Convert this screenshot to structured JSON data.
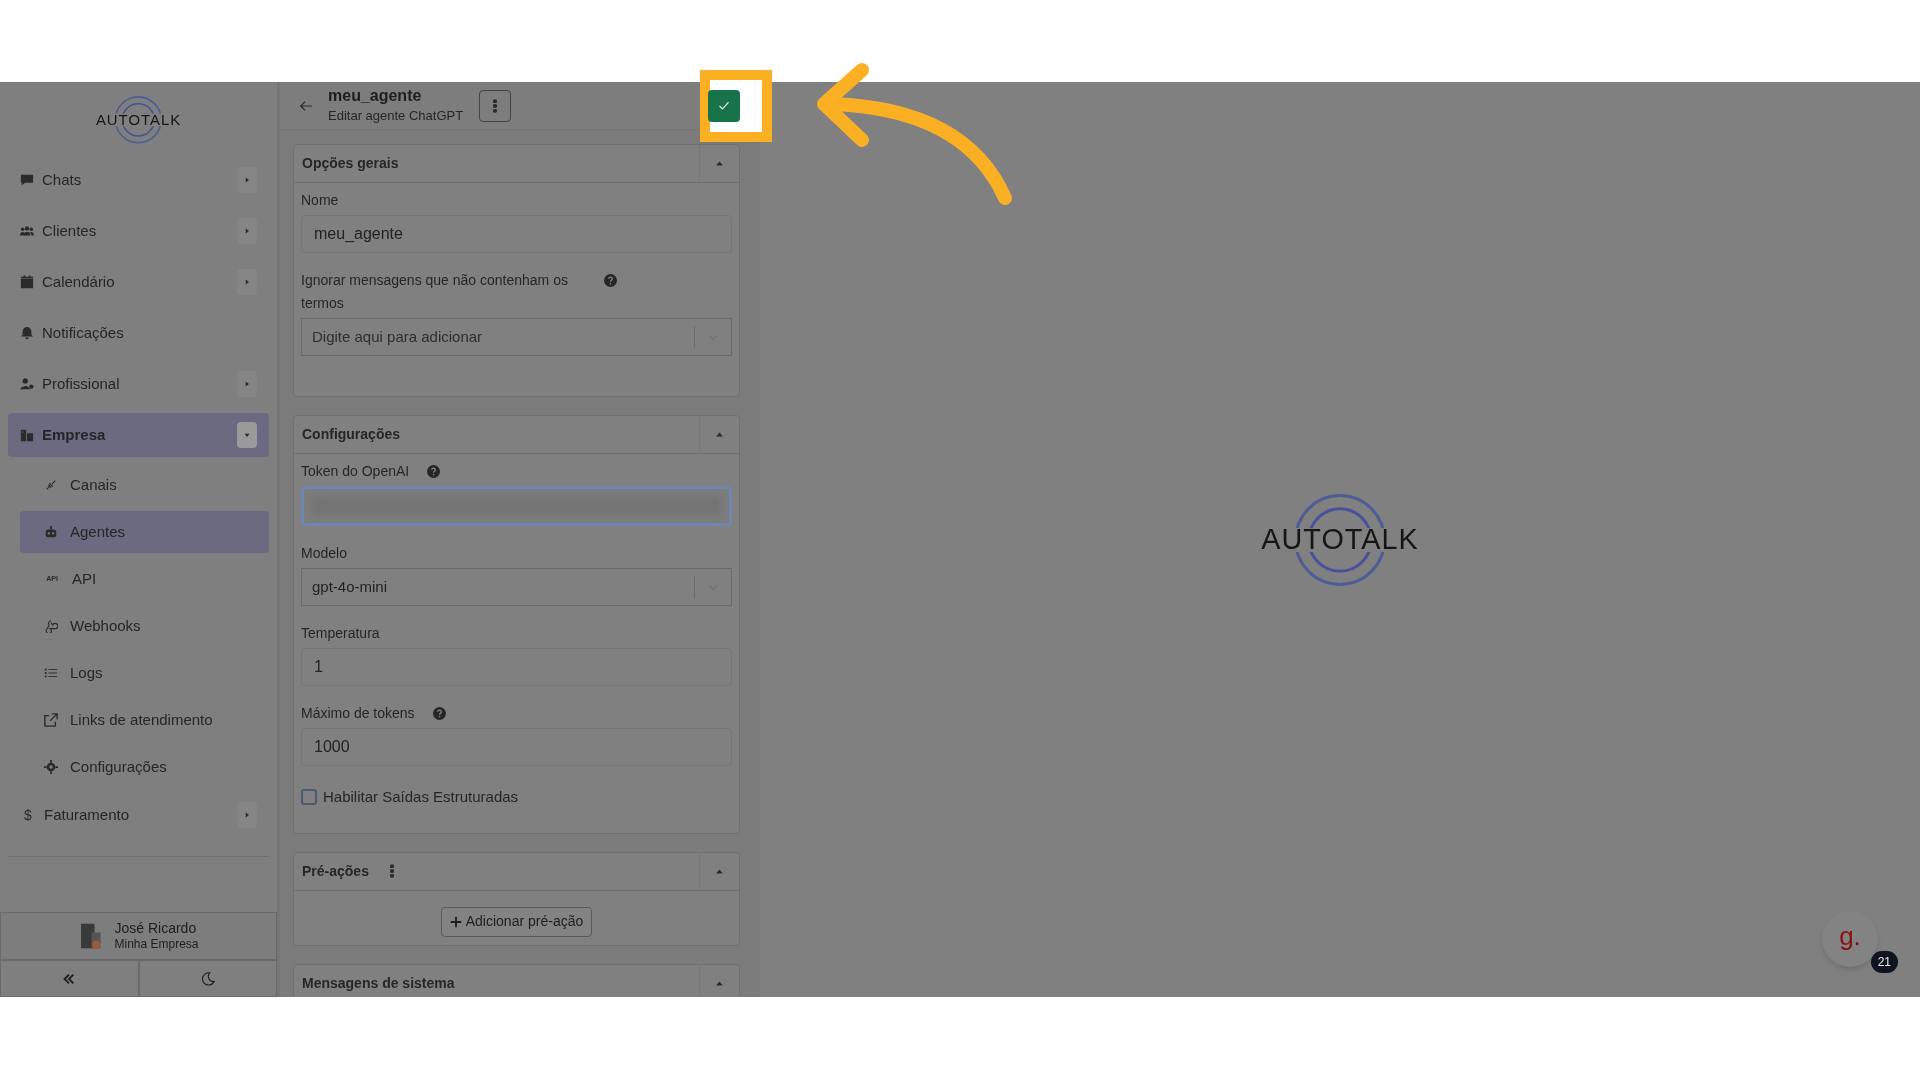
{
  "header": {
    "title": "meu_agente",
    "subtitle": "Editar agente ChatGPT"
  },
  "sidebar": {
    "logo": "AUTOTALK",
    "items": [
      {
        "label": "Chats",
        "kind": "group",
        "expanded": false,
        "selected": false
      },
      {
        "label": "Clientes",
        "kind": "group",
        "expanded": false,
        "selected": false
      },
      {
        "label": "Calendário",
        "kind": "group",
        "expanded": false,
        "selected": false
      },
      {
        "label": "Notificações",
        "kind": "link",
        "expanded": false,
        "selected": false
      },
      {
        "label": "Profissional",
        "kind": "group",
        "expanded": false,
        "selected": false
      },
      {
        "label": "Empresa",
        "kind": "group",
        "expanded": true,
        "selected": true,
        "children": [
          {
            "label": "Canais",
            "selected": false
          },
          {
            "label": "Agentes",
            "selected": true
          },
          {
            "label": "API",
            "icon_text": "API",
            "selected": false
          },
          {
            "label": "Webhooks",
            "selected": false
          },
          {
            "label": "Logs",
            "selected": false
          },
          {
            "label": "Links de atendimento",
            "selected": false
          },
          {
            "label": "Configurações",
            "selected": false
          }
        ]
      },
      {
        "label": "Faturamento",
        "kind": "group",
        "icon_text": "$",
        "expanded": false,
        "selected": false
      }
    ],
    "user": {
      "name": "José Ricardo",
      "company": "Minha Empresa"
    }
  },
  "sections": [
    {
      "title": "Opções gerais",
      "expanded": true,
      "has_menu": false,
      "fields": [
        {
          "kind": "text",
          "label": "Nome",
          "value": "meu_agente",
          "help": false
        },
        {
          "kind": "select",
          "label": "Ignorar mensagens que não contenham os termos",
          "placeholder": "Digite aqui para adicionar",
          "help": true
        }
      ]
    },
    {
      "title": "Configurações",
      "expanded": true,
      "has_menu": false,
      "fields": [
        {
          "kind": "secret",
          "label": "Token do OpenAI",
          "help": true
        },
        {
          "kind": "select",
          "label": "Modelo",
          "value": "gpt-4o-mini",
          "help": false
        },
        {
          "kind": "text",
          "label": "Temperatura",
          "value": "1",
          "help": false
        },
        {
          "kind": "text",
          "label": "Máximo de tokens",
          "value": "1000",
          "help": true
        },
        {
          "kind": "checkbox",
          "label": "Habilitar Saídas Estruturadas",
          "checked": false
        }
      ]
    },
    {
      "title": "Pré-ações",
      "expanded": true,
      "has_menu": true,
      "action": "Adicionar pré-ação"
    },
    {
      "title": "Mensagens de sistema",
      "expanded": true,
      "has_menu": false
    }
  ],
  "content_logo": "AUTOTALK",
  "chat_widget": {
    "logo": "g.",
    "badge": "21"
  }
}
